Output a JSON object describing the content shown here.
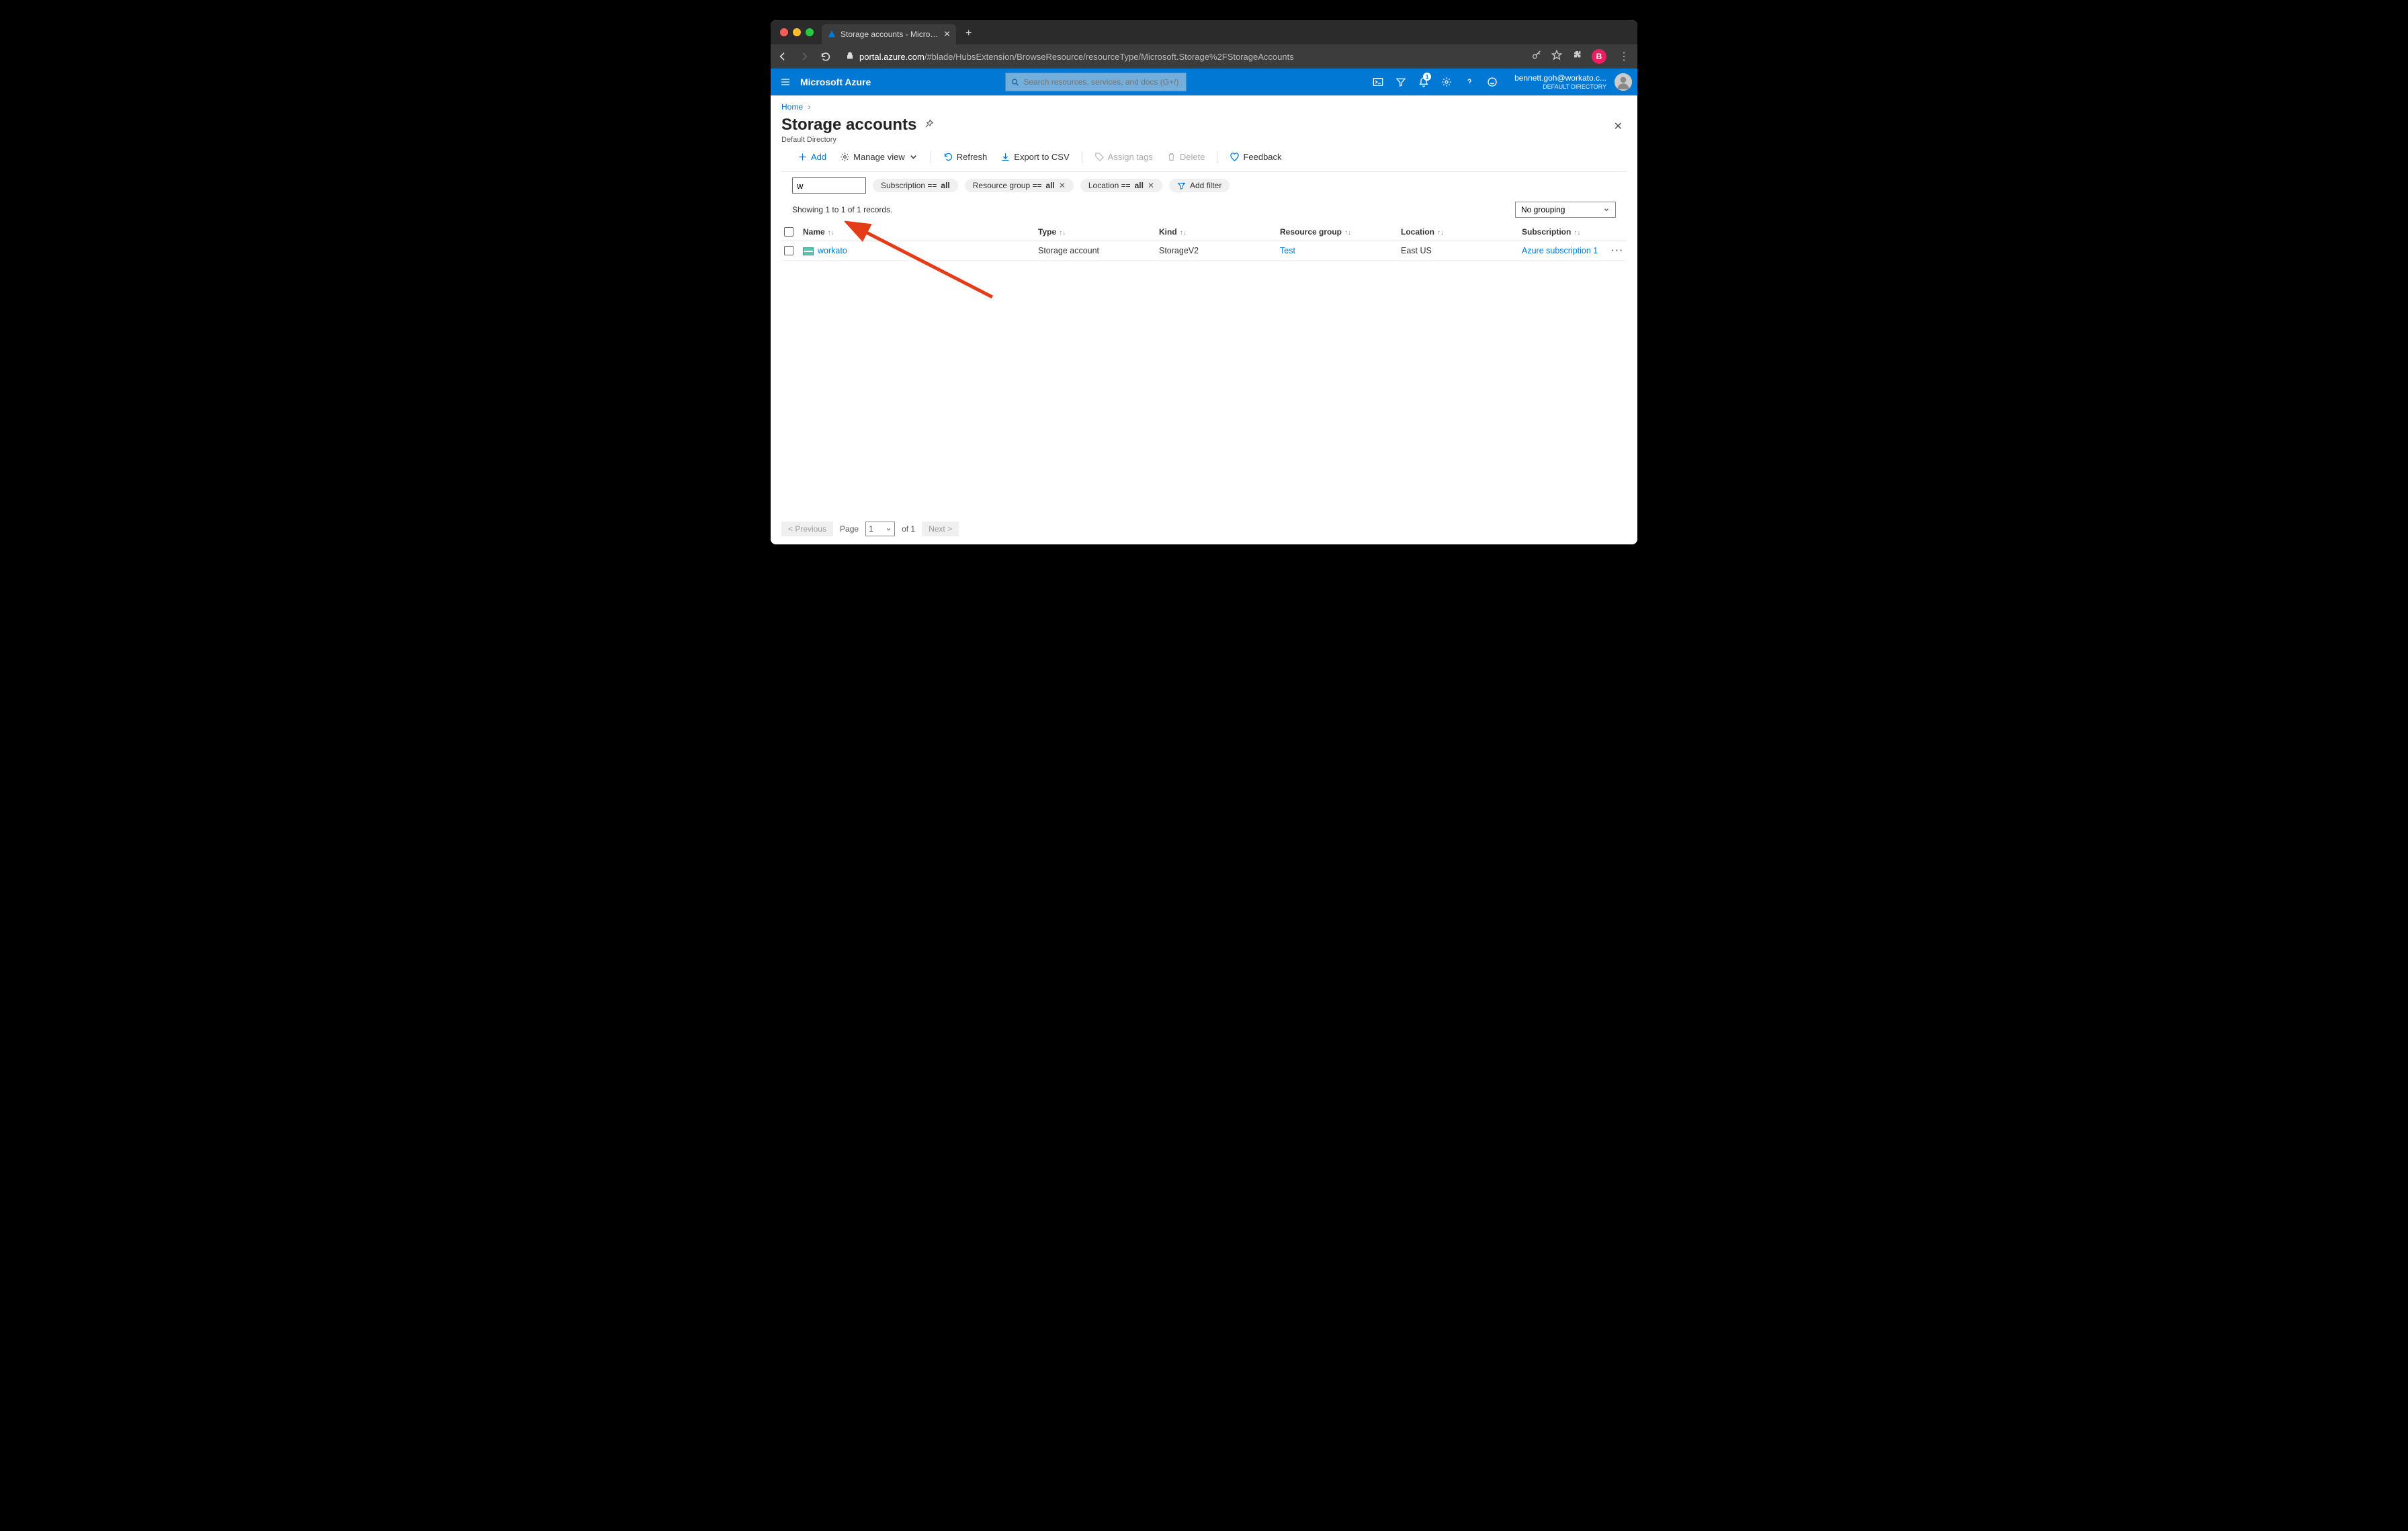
{
  "browser": {
    "tab_title": "Storage accounts - Microsoft A",
    "url_domain": "portal.azure.com",
    "url_path": "/#blade/HubsExtension/BrowseResource/resourceType/Microsoft.Storage%2FStorageAccounts"
  },
  "azure_header": {
    "brand": "Microsoft Azure",
    "search_placeholder": "Search resources, services, and docs (G+/)",
    "notif_count": "1",
    "user_email": "bennett.goh@workato.c...",
    "user_dir": "DEFAULT DIRECTORY"
  },
  "breadcrumb": {
    "home": "Home"
  },
  "page": {
    "title": "Storage accounts",
    "subtitle": "Default Directory"
  },
  "toolbar": {
    "add": "Add",
    "manage_view": "Manage view",
    "refresh": "Refresh",
    "export": "Export to CSV",
    "assign_tags": "Assign tags",
    "delete": "Delete",
    "feedback": "Feedback"
  },
  "filters": {
    "input_value": "w",
    "subscription_label": "Subscription == ",
    "subscription_val": "all",
    "rg_label": "Resource group == ",
    "rg_val": "all",
    "loc_label": "Location == ",
    "loc_val": "all",
    "add_filter": "Add filter"
  },
  "records": {
    "text": "Showing 1 to 1 of 1 records.",
    "grouping": "No grouping"
  },
  "table": {
    "headers": {
      "name": "Name",
      "type": "Type",
      "kind": "Kind",
      "rg": "Resource group",
      "location": "Location",
      "subscription": "Subscription"
    },
    "rows": [
      {
        "name": "workato",
        "type": "Storage account",
        "kind": "StorageV2",
        "rg": "Test",
        "location": "East US",
        "subscription": "Azure subscription 1"
      }
    ]
  },
  "pager": {
    "prev": "< Previous",
    "page_label": "Page",
    "page_val": "1",
    "of": "of 1",
    "next": "Next >"
  }
}
